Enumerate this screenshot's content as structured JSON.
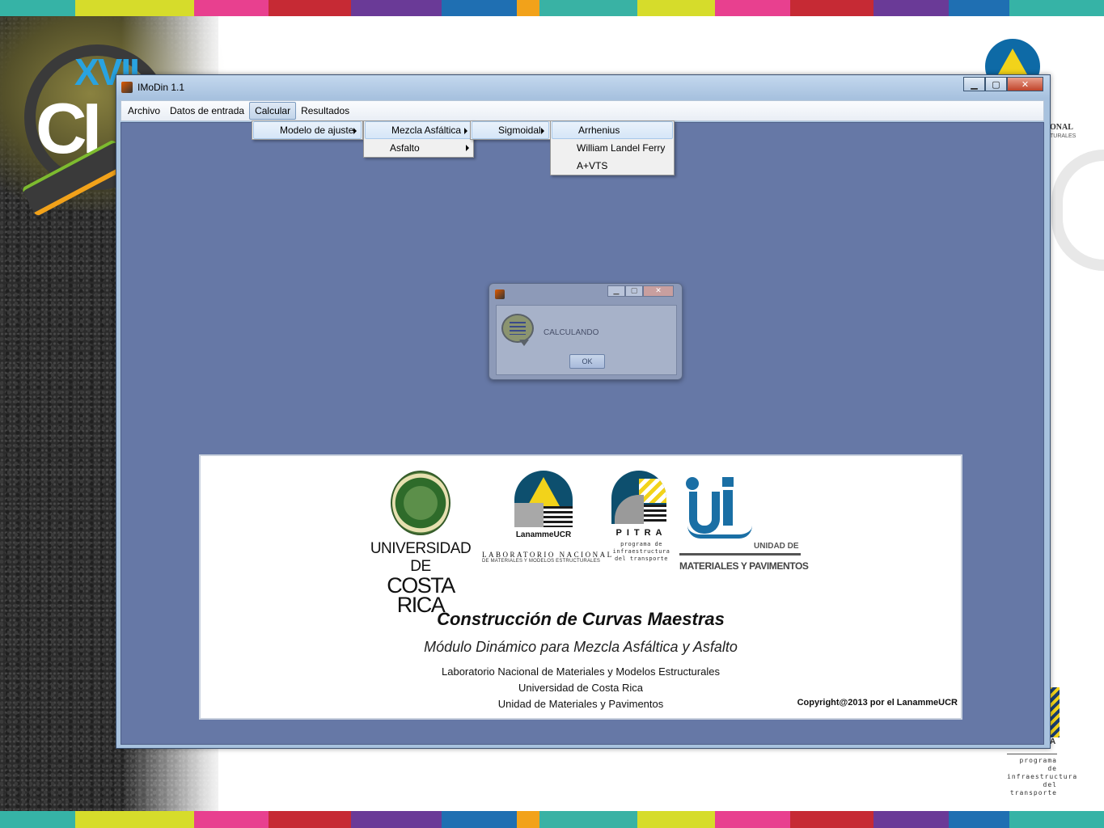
{
  "colors": {
    "stripe_palette": [
      "#36b3a6",
      "#d6dc2b",
      "#e8408f",
      "#c62a34",
      "#6a3a97",
      "#1f6fb2",
      "#f2a21a",
      "#39b2a4",
      "#d6dc2b",
      "#e8408f",
      "#c62a34",
      "#6a3a97",
      "#1f6fb2",
      "#36b3a6"
    ],
    "client_background": "#6678a6",
    "accent": "#1a6fa5"
  },
  "slide": {
    "event_logo": {
      "text_top": "XVII",
      "text_main": "CI"
    },
    "corner_brand_text": "ONAL",
    "corner_brand_text2": "TURALES",
    "pitra_corner_letter": "A",
    "pitra_corner_caption": [
      "programa de",
      "infraestructura",
      "del transporte"
    ]
  },
  "window": {
    "title": "IMoDin 1.1",
    "buttons": {
      "minimize": "▁",
      "maximize": "▢",
      "close": "✕"
    }
  },
  "menubar": {
    "items": [
      "Archivo",
      "Datos de entrada",
      "Calcular",
      "Resultados"
    ],
    "active": "Calcular"
  },
  "menus": {
    "calcular": [
      "Modelo de ajuste"
    ],
    "modelo_de_ajuste": [
      "Mezcla Asfáltica",
      "Asfalto"
    ],
    "mezcla_asfaltica": [
      "Sigmoidal"
    ],
    "sigmoidal": [
      "Arrhenius",
      "William Landel Ferry",
      "A+VTS"
    ]
  },
  "dialog": {
    "message": "CALCULANDO",
    "ok_label": "OK",
    "buttons": {
      "minimize": "▁",
      "maximize": "▢",
      "close": "✕"
    }
  },
  "splash": {
    "ucr": {
      "line1": "UNIVERSIDAD DE",
      "line2": "COSTA RICA"
    },
    "lanamme": {
      "name": "LanammeUCR",
      "sub1": "LABORATORIO NACIONAL",
      "sub2": "DE MATERIALES Y MODELOS ESTRUCTURALES"
    },
    "pitra": {
      "name": "PITRA",
      "sub": [
        "programa de",
        "infraestructura",
        "del transporte"
      ]
    },
    "ump": {
      "unidad": "UNIDAD DE",
      "name": "MATERIALES Y PAVIMENTOS"
    },
    "title": "Construcción de Curvas Maestras",
    "subtitle": "Módulo Dinámico para Mezcla Asfáltica y Asfalto",
    "line1": "Laboratorio Nacional de Materiales y Modelos Estructurales",
    "line2": "Universidad de Costa Rica",
    "line3": "Unidad de Materiales y Pavimentos",
    "copyright": "Copyright@2013 por el LanammeUCR"
  }
}
